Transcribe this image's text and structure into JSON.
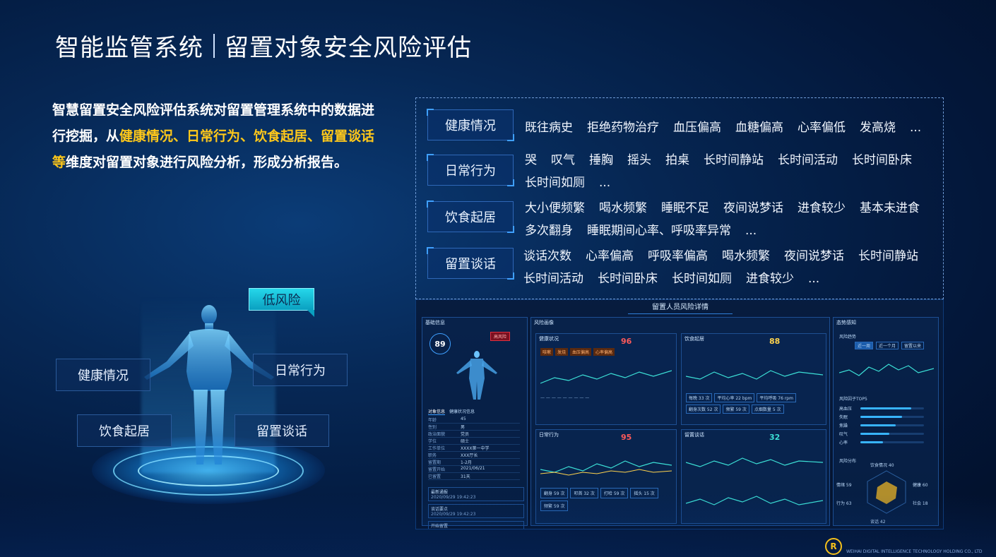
{
  "header": {
    "title_main": "智能监管系统",
    "title_sub": "留置对象安全风险评估"
  },
  "intro": {
    "part1": "智慧留置安全风险评估系统对留置管理系统中的数据进行挖掘，从",
    "highlight": "健康情况、日常行为、饮食起居、留置谈话等",
    "part2": "维度对留置对象进行风险分析，形成分析报告。"
  },
  "categories": [
    {
      "label": "健康情况",
      "lines": [
        [
          "既往病史",
          "拒绝药物治疗",
          "血压偏高",
          "血糖偏高",
          "心率偏低",
          "发高烧",
          "..."
        ]
      ]
    },
    {
      "label": "日常行为",
      "lines": [
        [
          "哭",
          "叹气",
          "捶胸",
          "摇头",
          "拍桌",
          "长时间静站",
          "长时间活动",
          "长时间卧床"
        ],
        [
          "长时间如厕",
          "..."
        ]
      ]
    },
    {
      "label": "饮食起居",
      "lines": [
        [
          "大小便频繁",
          "喝水频繁",
          "睡眠不足",
          "夜间说梦话",
          "进食较少",
          "基本未进食"
        ],
        [
          "多次翻身",
          "睡眠期间心率、呼吸率异常",
          "..."
        ]
      ]
    },
    {
      "label": "留置谈话",
      "lines": [
        [
          "谈话次数",
          "心率偏高",
          "呼吸率偏高",
          "喝水频繁",
          "夜间说梦话",
          "长时间静站"
        ],
        [
          "长时间活动",
          "长时间卧床",
          "长时间如厕",
          "进食较少",
          "..."
        ]
      ]
    }
  ],
  "figure": {
    "risk_label": "低风险",
    "dims": {
      "health": "健康情况",
      "behavior": "日常行为",
      "diet": "饮食起居",
      "talk": "留置谈话"
    }
  },
  "dashboard": {
    "title": "留置人员风险详情",
    "basic": {
      "header": "基础信息",
      "score": "89",
      "badge": "高风险",
      "info_tabs": [
        "对象信息",
        "健康状况信息"
      ],
      "rows": [
        [
          "年龄",
          "45"
        ],
        [
          "性别",
          "男"
        ],
        [
          "政治面貌",
          "党员"
        ],
        [
          "学位",
          "硕士"
        ],
        [
          "工作单位",
          "XXXX第一中学"
        ],
        [
          "职务",
          "XXX厅长"
        ],
        [
          "留置期",
          "1-2月"
        ],
        [
          "留置开始",
          "2021/06/21"
        ],
        [
          "已留置",
          "31天"
        ]
      ],
      "events": [
        [
          "最新通报",
          "2020/09/29 19:42:23"
        ],
        [
          "谈话要点",
          "2020/09/29 19:42:23"
        ],
        [
          "开始留置",
          "2020/09/29 19:42:23"
        ]
      ]
    },
    "risk": {
      "header": "风险画像",
      "panels": [
        {
          "name": "健康状况",
          "score": "96"
        },
        {
          "name": "饮食起居",
          "score": "88"
        },
        {
          "name": "日常行为",
          "score": "95"
        },
        {
          "name": "留置谈话",
          "score": "32"
        }
      ],
      "tags1": [
        "咳嗽",
        "发烧",
        "血压偏高",
        "心率偏高"
      ],
      "chips": [
        "每晚 33 次",
        "平均心率 22 bpm",
        "平均呼吸 76 rpm",
        "翻身次数 52 次",
        "频繁 59 次",
        "点烟数量 5 次"
      ],
      "freq": [
        "翻身 59 次",
        "叩首 32 次",
        "打哈 59 次",
        "摇头 15 次",
        "频繁 59 次"
      ]
    },
    "side": {
      "header": "态势感知",
      "trend": "风险趋势",
      "trend_tabs": [
        "近一周",
        "近一个月",
        "留置以来"
      ],
      "top5": "风险因子TOP5",
      "bars": [
        [
          "高血压",
          0.8
        ],
        [
          "失眠",
          0.65
        ],
        [
          "焦躁",
          0.55
        ],
        [
          "叹气",
          0.45
        ],
        [
          "心率",
          0.35
        ]
      ],
      "radar_title": "风险分布",
      "radar": [
        [
          "饮食情况",
          "40"
        ],
        [
          "健康",
          "60"
        ],
        [
          "社会",
          "18"
        ],
        [
          "谈话",
          "42"
        ],
        [
          "行为",
          "63"
        ],
        [
          "情绪",
          "59"
        ]
      ]
    }
  },
  "logo": {
    "mark": "R",
    "name": "",
    "sub": "WEIHAI DIGITAL INTELLIGENCE TECHNOLOGY HOLDING CO., LTD"
  }
}
